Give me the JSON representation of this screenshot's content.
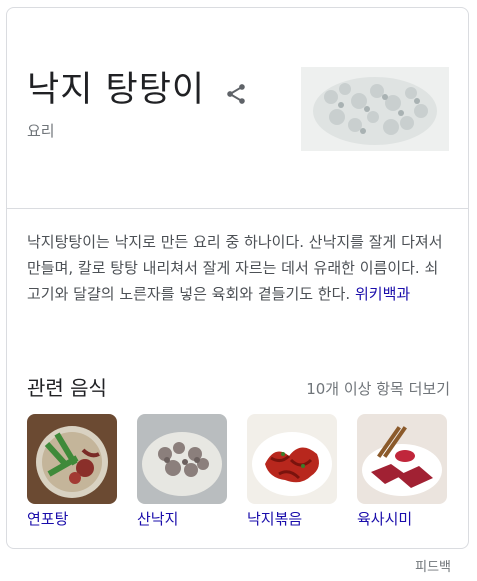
{
  "entity": {
    "title": "낙지 탕탕이",
    "subtitle": "요리",
    "image_icon": "raw-chopped-octopus-photo"
  },
  "description": {
    "text": "낙지탕탕이는 낙지로 만든 요리 중 하나이다. 산낙지를 잘게 다져서 만들며, 칼로 탕탕 내리쳐서 잘게 자르는 데서 유래한 이름이다. 쇠고기와 달걀의 노른자를 넣은 육회와 곁들기도 한다.",
    "source_link": "위키백과"
  },
  "related": {
    "heading": "관련 음식",
    "more_link": "10개 이상 항목 더보기",
    "items": [
      {
        "label": "연포탕"
      },
      {
        "label": "산낙지"
      },
      {
        "label": "낙지볶음"
      },
      {
        "label": "육사시미"
      }
    ]
  },
  "footer": {
    "feedback": "피드백"
  },
  "colors": {
    "link": "#1a0dab",
    "muted": "#70757a",
    "border": "#dadce0"
  }
}
